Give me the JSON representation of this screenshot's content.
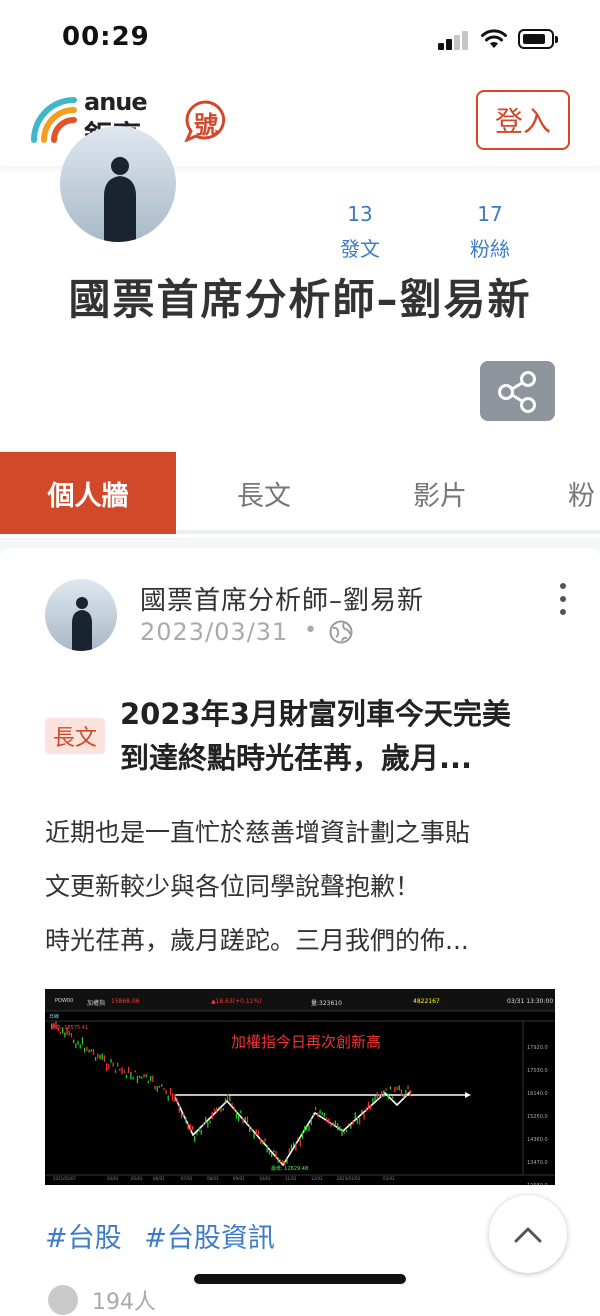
{
  "status_bar": {
    "time": "00:29"
  },
  "header": {
    "logo_text": "anue",
    "logo_cn": "鉅亨",
    "hao_glyph": "號",
    "login_label": "登入"
  },
  "profile": {
    "name": "國票首席分析師–劉易新",
    "stats": [
      {
        "value": "13",
        "label": "發文"
      },
      {
        "value": "17",
        "label": "粉絲"
      }
    ]
  },
  "tabs": [
    {
      "label": "個人牆",
      "active": true
    },
    {
      "label": "長文",
      "active": false
    },
    {
      "label": "影片",
      "active": false
    },
    {
      "label": "粉",
      "active": false
    }
  ],
  "post": {
    "author": "國票首席分析師–劉易新",
    "date": "2023/03/31",
    "separator": "•",
    "badge": "長文",
    "title_line1": "2023年3月財富列車今天完美",
    "title_line2": "到達終點時光荏苒，歲月...",
    "body_line1": "近期也是一直忙於慈善增資計劃之事貼",
    "body_line2": "文更新較少與各位同學說聲抱歉！",
    "body_line3": "時光荏苒，歲月蹉跎。三月我們的佈...",
    "hashtags": [
      "#台股",
      "#台股資訊"
    ],
    "footer_peek": "194人",
    "chart_image": {
      "annotation": "加權指今日再次創新高",
      "index_name": "加權指",
      "index_value": "15868.06",
      "change": "▲18.63(+0.11%)",
      "volume_label": "量:323610",
      "right_value": "4822167",
      "timestamp": "03/31 13:30:00",
      "code": "POW00",
      "period": "日線",
      "high_label": "最高: 18575.41",
      "low_label": "最低: 12629.48",
      "y_ticks": [
        "17920.0",
        "17030.0",
        "16140.0",
        "15250.0",
        "14360.0",
        "13470.0",
        "12580.0"
      ],
      "x_ticks": [
        "2022/02/07",
        "04/01",
        "05/03",
        "06/01",
        "07/01",
        "08/03",
        "09/01",
        "10/03",
        "11/01",
        "12/01",
        "2023/01/03",
        "03/01"
      ]
    }
  },
  "colors": {
    "accent": "#d2492a",
    "link": "#3d7cc9",
    "share_bg": "#8e959c"
  }
}
